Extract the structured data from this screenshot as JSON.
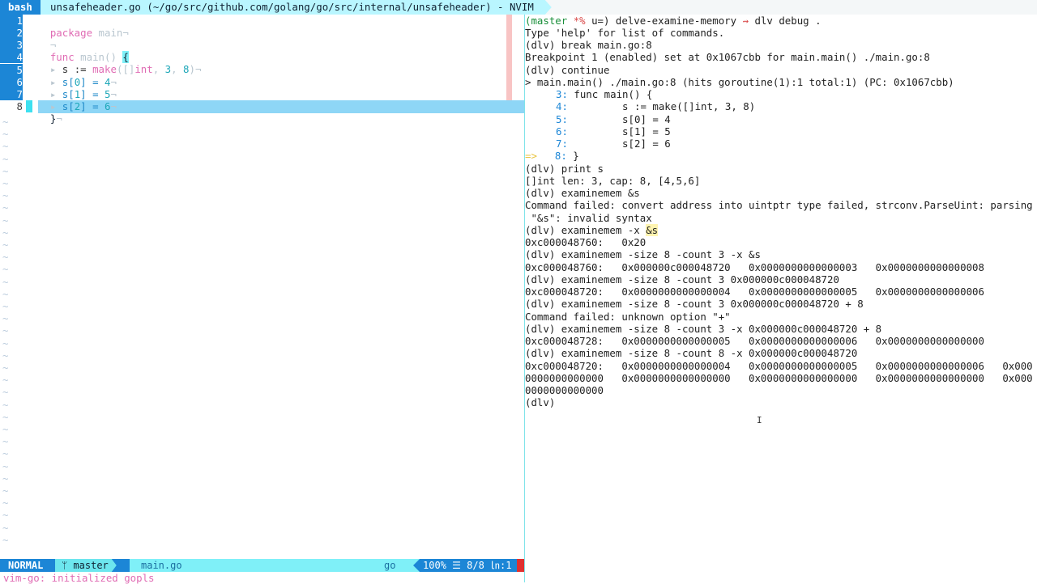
{
  "titlebar": {
    "tab": "bash",
    "title": "unsafeheader.go (~/go/src/github.com/golang/go/src/internal/unsafeheader) - NVIM"
  },
  "editor": {
    "line_numbers": [
      "1",
      "2",
      "3",
      "4",
      "5",
      "6",
      "7",
      "8"
    ],
    "lines": [
      {
        "t1": "package",
        "t2": " main"
      },
      {
        "t1": ""
      },
      {
        "t1": "func",
        "t2": " main() ",
        "t3": "{"
      },
      {
        "t1": "s := ",
        "t2": "make",
        "t3": "([]",
        "t4": "int",
        "t5": ", ",
        "t6": "3",
        "t7": ", ",
        "t8": "8",
        "t9": ")"
      },
      {
        "t1": "s[",
        "t2": "0",
        "t3": "] = ",
        "t4": "4"
      },
      {
        "t1": "s[",
        "t2": "1",
        "t3": "] = ",
        "t4": "5"
      },
      {
        "t1": "s[",
        "t2": "2",
        "t3": "] = ",
        "t4": "6"
      },
      {
        "t1": "}"
      }
    ],
    "eol_marker": "¬",
    "tab_marker": "▸",
    "tilde": "~"
  },
  "statusline": {
    "mode": "NORMAL",
    "branch": "ᛘ master",
    "filename": "main.go",
    "filetype": "go",
    "percent": "100%",
    "position": "☰ 8/8",
    "column": "㏑:1",
    "message": "vim-go: initialized gopls"
  },
  "terminal": {
    "lines": {
      "l0_branch": "(master ",
      "l0_star": "*%",
      "l0_rest": " u=) delve-examine-memory ",
      "l0_arrow": "⇝",
      "l0_cmd": " dlv debug .",
      "l1": "Type 'help' for list of commands.",
      "l2": "(dlv) break main.go:8",
      "l3": "Breakpoint 1 (enabled) set at 0x1067cbb for main.main() ./main.go:8",
      "l4": "(dlv) continue",
      "l5": "> main.main() ./main.go:8 (hits goroutine(1):1 total:1) (PC: 0x1067cbb)",
      "src3_n": "3:",
      "src3": " func main() {",
      "src4_n": "4:",
      "src4": "         s := make([]int, 3, 8)",
      "src5_n": "5:",
      "src5": "         s[0] = 4",
      "src6_n": "6:",
      "src6": "         s[1] = 5",
      "src7_n": "7:",
      "src7": "         s[2] = 6",
      "src8_arrow": "=>",
      "src8_n": "8:",
      "src8": " }",
      "l12": "(dlv) print s",
      "l13": "[]int len: 3, cap: 8, [4,5,6]",
      "l14": "(dlv) examinemem &s",
      "l15": "Command failed: convert address into uintptr type failed, strconv.ParseUint: parsing",
      "l16": " \"&s\": invalid syntax",
      "l17_a": "(dlv) examinemem -x ",
      "l17_b": "&s",
      "l18": "0xc000048760:   0x20",
      "l19": "(dlv) examinemem -size 8 -count 3 -x &s",
      "l20": "0xc000048760:   0x000000c000048720   0x0000000000000003   0x0000000000000008",
      "l21": "(dlv) examinemem -size 8 -count 3 0x000000c000048720",
      "l22": "0xc000048720:   0x0000000000000004   0x0000000000000005   0x0000000000000006",
      "l23": "(dlv) examinemem -size 8 -count 3 0x000000c000048720 + 8",
      "l24": "Command failed: unknown option \"+\"",
      "l25": "(dlv) examinemem -size 8 -count 3 -x 0x000000c000048720 + 8",
      "l26": "0xc000048728:   0x0000000000000005   0x0000000000000006   0x0000000000000000",
      "l27": "(dlv) examinemem -size 8 -count 8 -x 0x000000c000048720",
      "l28": "0xc000048720:   0x0000000000000004   0x0000000000000005   0x0000000000000006   0x000",
      "l29": "0000000000000   0x0000000000000000   0x0000000000000000   0x0000000000000000   0x000",
      "l30": "0000000000000",
      "l31": "(dlv)"
    },
    "ibeam": "I"
  },
  "colors": {
    "accent": "#1c86d6",
    "cyan": "#7ff0f8",
    "pink": "#e06cb4",
    "error": "#e03030"
  }
}
